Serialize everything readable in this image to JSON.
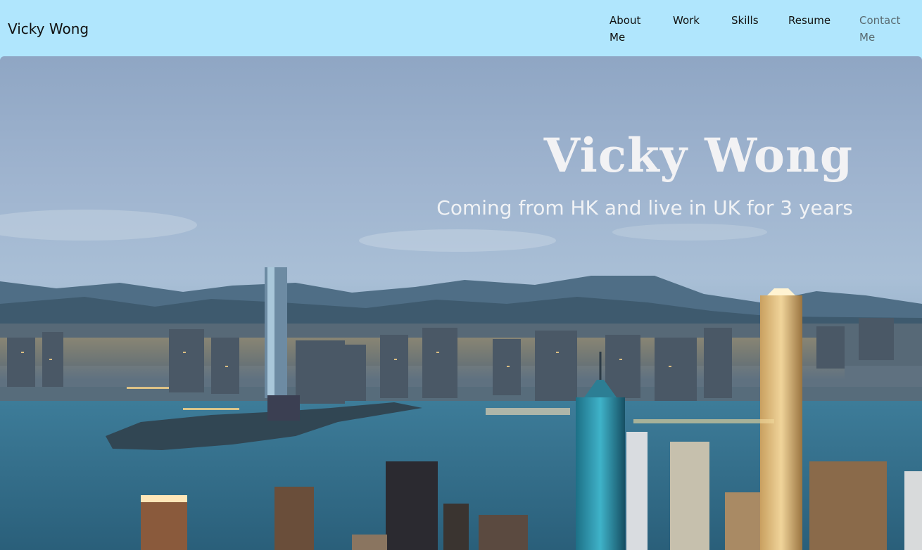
{
  "brand": "Vicky Wong",
  "nav": {
    "about": "About Me",
    "work": "Work",
    "skills": "Skills",
    "resume": "Resume",
    "contact": "Contact Me"
  },
  "hero": {
    "title": "Vicky Wong",
    "subtitle": "Coming from HK and live in UK for 3 years"
  },
  "colors": {
    "navbar_bg": "#b0e6fd",
    "hero_text": "#f2f2f4"
  }
}
